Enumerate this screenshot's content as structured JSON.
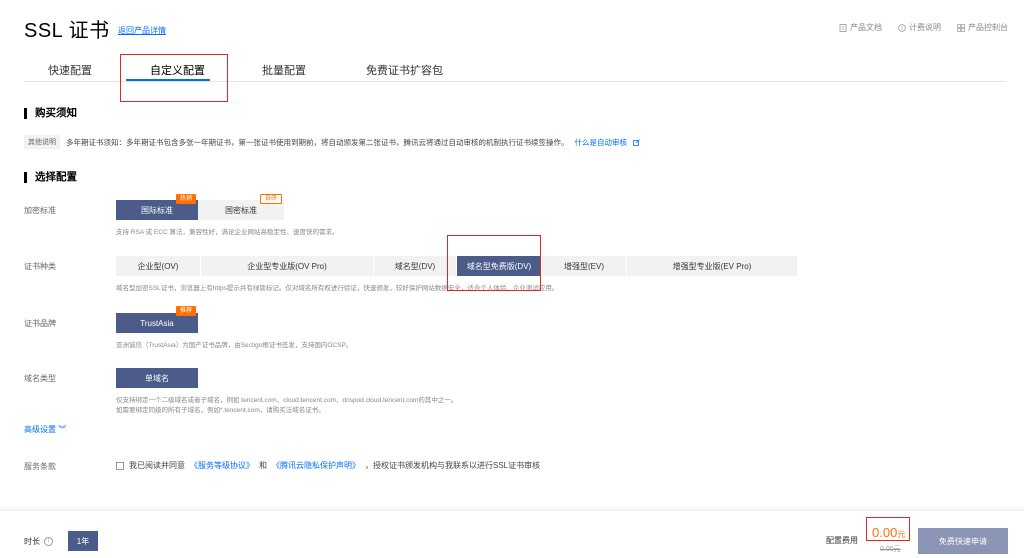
{
  "header": {
    "title": "SSL 证书",
    "back_link": "返回产品详情",
    "links": [
      {
        "icon": "doc-icon",
        "label": "产品文档"
      },
      {
        "icon": "info-icon",
        "label": "计费说明"
      },
      {
        "icon": "grid-icon",
        "label": "产品控制台"
      }
    ]
  },
  "tabs": [
    "快速配置",
    "自定义配置",
    "批量配置",
    "免费证书扩容包"
  ],
  "notice": {
    "section_title": "购买须知",
    "tag": "其他说明",
    "text": "多年期证书须知：多年期证书包含多张一年期证书，第一张证书使用到期前，将自动颁发第二张证书，腾讯云将通过自动审核的机制执行证书续签操作。",
    "link": "什么是自动审核"
  },
  "config": {
    "section_title": "选择配置",
    "encryption": {
      "label": "加密标准",
      "options": [
        "国际标准",
        "国密标准"
      ],
      "badges": [
        "热销",
        "自研"
      ],
      "hint": "支持 RSA 或 ECC 算法，兼容性好，满足企业网站高稳定性、速度快的需求。"
    },
    "cert_type": {
      "label": "证书种类",
      "options": [
        "企业型(OV)",
        "企业型专业版(OV Pro)",
        "域名型(DV)",
        "域名型免费版(DV)",
        "增强型(EV)",
        "增强型专业版(EV Pro)"
      ],
      "hint": "域名型加密SSL证书，浏览器上有https提示并有绿锁标记。仅对域名所有权进行验证，快速颁发，较好保护网站数据安全，适合个人体验、企业测试应用。"
    },
    "brand": {
      "label": "证书品牌",
      "option": "TrustAsia",
      "badge": "推荐",
      "hint": "亚洲诚信（TrustAsia）为国产证书品牌，由Sectigo根证书签发，支持国内OCSP。"
    },
    "domain_type": {
      "label": "域名类型",
      "option": "单域名",
      "hint1": "仅支持绑定一个二级域名或者子域名，例如 tencent.com、cloud.tencent.com、dnspod.cloud.tencent.com的其中之一。",
      "hint2": "如需要绑定同级的所有子域名，例如*.tencent.com，请购买泛域名证书。"
    },
    "advanced": "高级设置",
    "terms": {
      "label": "服务条款",
      "pre": "我已阅读并同意",
      "link1": "《服务等级协议》",
      "and": "和",
      "link2": "《腾讯云隐私保护声明》",
      "post": "，授权证书颁发机构与我联系以进行SSL证书审核"
    }
  },
  "footer": {
    "duration_label": "时长",
    "duration_value": "1年",
    "fee_label": "配置费用",
    "price": "0.00",
    "price_unit": "元",
    "original_price": "0.00元",
    "buy_button": "免费快速申请"
  }
}
